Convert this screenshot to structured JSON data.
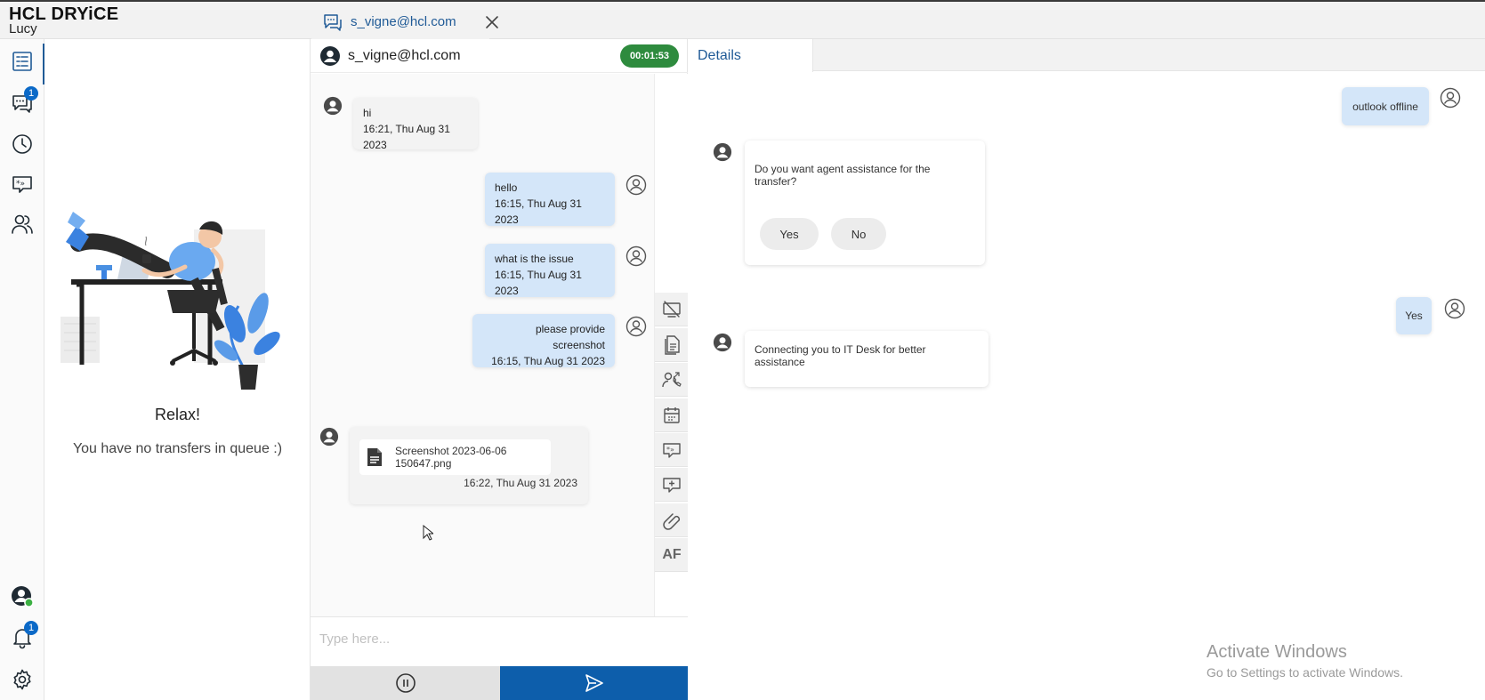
{
  "app": {
    "brand_bold": "HCL",
    "brand_name": "DRYiCE",
    "user": "Lucy",
    "active_tab_label": "s_vigne@hcl.com"
  },
  "nav": {
    "chat_badge": "1",
    "notification_badge": "1",
    "accent_color": "#1f5a96"
  },
  "transfers": {
    "title": "Relax!",
    "subtitle": "You have no transfers in queue :)"
  },
  "chat": {
    "contact": "s_vigne@hcl.com",
    "timer": "00:01:53",
    "messages": [
      {
        "direction": "in",
        "text": "hi",
        "time": "16:21, Thu Aug 31 2023"
      },
      {
        "direction": "out",
        "text": "hello",
        "time": "16:15, Thu Aug 31 2023"
      },
      {
        "direction": "out",
        "text": "what is the issue",
        "time": "16:15, Thu Aug 31 2023"
      },
      {
        "direction": "out",
        "text": "please provide screenshot",
        "time": "16:15, Thu Aug 31 2023"
      }
    ],
    "file_message": {
      "filename": "Screenshot 2023-06-06 150647.png",
      "time": "16:22, Thu Aug 31 2023"
    },
    "tools_af_label": "AF",
    "composer_placeholder": "Type here..."
  },
  "details": {
    "tab_label": "Details",
    "messages": {
      "outlook": "outlook offline",
      "question": "Do you want agent assistance for the transfer?",
      "yes_option": "Yes",
      "no_option": "No",
      "user_reply": "Yes",
      "connecting": "Connecting you to IT Desk for better assistance"
    }
  },
  "watermark": {
    "title": "Activate Windows",
    "subtitle": "Go to Settings to activate Windows."
  }
}
